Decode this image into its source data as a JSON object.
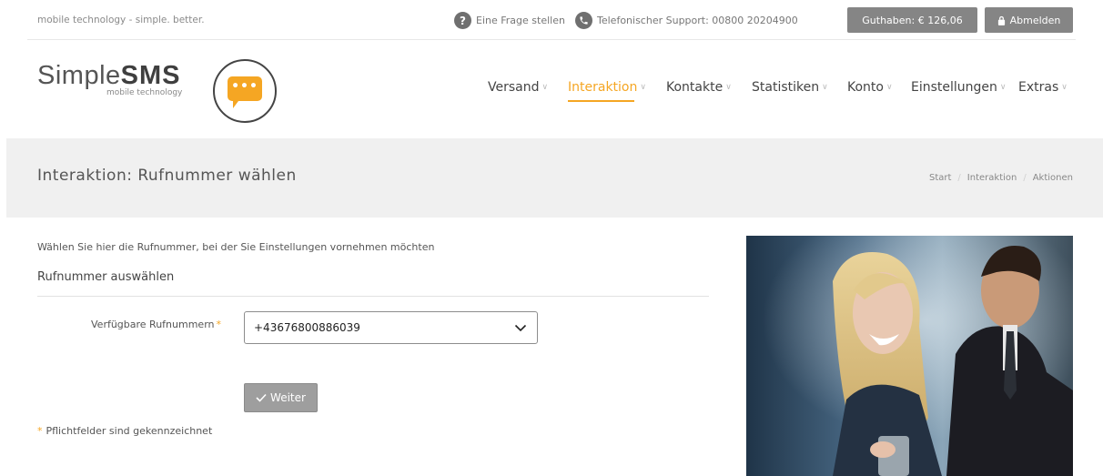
{
  "topbar": {
    "tagline": "mobile technology - simple. better.",
    "help_label": "Eine Frage stellen",
    "support_label": "Telefonischer Support: 00800 20204900",
    "balance_label": "Guthaben: € 126,06",
    "logout_label": "Abmelden"
  },
  "logo": {
    "brand_light": "Simple",
    "brand_bold": "SMS",
    "tagline": "mobile technology"
  },
  "nav": {
    "items": [
      {
        "label": "Versand"
      },
      {
        "label": "Interaktion"
      },
      {
        "label": "Kontakte"
      },
      {
        "label": "Statistiken"
      },
      {
        "label": "Konto"
      },
      {
        "label": "Einstellungen"
      },
      {
        "label": "Extras"
      }
    ],
    "active_index": 1
  },
  "page": {
    "title": "Interaktion: Rufnummer wählen",
    "breadcrumb": [
      "Start",
      "Interaktion",
      "Aktionen"
    ]
  },
  "content": {
    "intro": "Wählen Sie hier die Rufnummer, bei der Sie Einstellungen vornehmen möchten",
    "section_title": "Rufnummer auswählen",
    "field_label": "Verfügbare Rufnummern",
    "required_mark": "*",
    "select_value": "+43676800886039",
    "submit_label": "Weiter",
    "footnote": "Pflichtfelder sind gekennzeichnet"
  },
  "colors": {
    "accent": "#f5a623",
    "button_grey": "#858585",
    "band_bg": "#f0f0f0"
  },
  "icons": {
    "help": "question-circle-icon",
    "phone": "phone-circle-icon",
    "lock": "lock-icon",
    "check": "check-icon",
    "caret": "chevron-down-icon"
  }
}
